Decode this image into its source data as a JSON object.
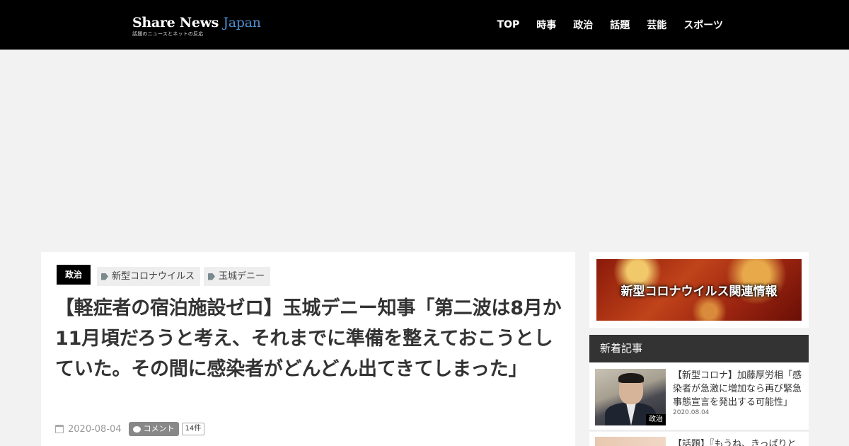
{
  "header": {
    "logo_main": "Share News ",
    "logo_accent": "Japan",
    "logo_sub": "話題のニュースとネットの反応",
    "nav": [
      "TOP",
      "時事",
      "政治",
      "話題",
      "芸能",
      "スポーツ"
    ]
  },
  "article": {
    "category": "政治",
    "tags": [
      "新型コロナウイルス",
      "玉城デニー"
    ],
    "title": "【軽症者の宿泊施設ゼロ】玉城デニー知事「第二波は8月か11月頃だろうと考え、それまでに準備を整えておこうとしていた。その間に感染者がどんどん出てきてしまった」",
    "date": "2020-08-04",
    "comment_label": "コメント",
    "comment_count": "14件"
  },
  "sidebar": {
    "banner_text": "新型コロナウイルス関連情報",
    "recent_heading": "新着記事",
    "posts": [
      {
        "title": "【新型コロナ】加藤厚労相「感染者が急激に増加なら再び緊急事態宣言を発出する可能性」",
        "date": "2020.08.04",
        "category": "政治"
      },
      {
        "title": "【話題】『もうね、きっぱりと"
      }
    ]
  },
  "colors": {
    "header_bg": "#000000",
    "logo_accent": "#4e8fd0",
    "sidebar_heading_bg": "#333333",
    "page_bg": "#f2f2f2"
  }
}
